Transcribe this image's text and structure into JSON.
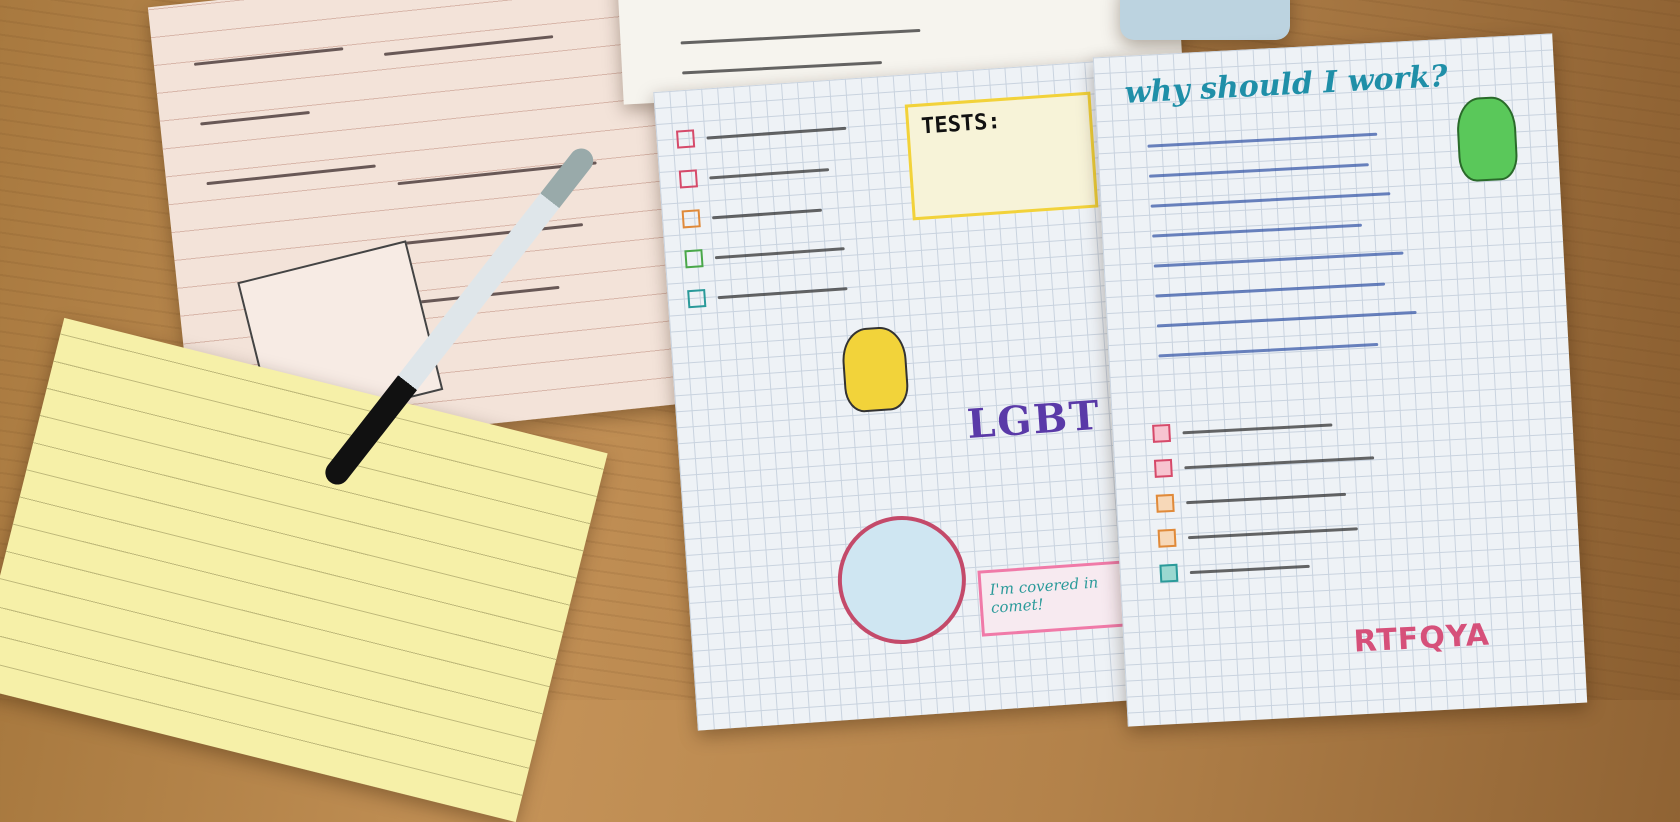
{
  "scene": "photo of open bullet-journal notebooks and a yellow notepad with a pen on a wooden desk",
  "heading_right_page": "why should I work?",
  "tests_box_title": "TESTS:",
  "badge_text": "LGBT",
  "quote_text": "I'm covered in comet!",
  "corner_letters": "RTFQYA",
  "colors": {
    "desk": "#b3824a",
    "left_notebook": "#f3e3d9",
    "grid_page": "#eef2f6",
    "notepad": "#f6f0a8",
    "heading_ink": "#1f8fa8"
  }
}
